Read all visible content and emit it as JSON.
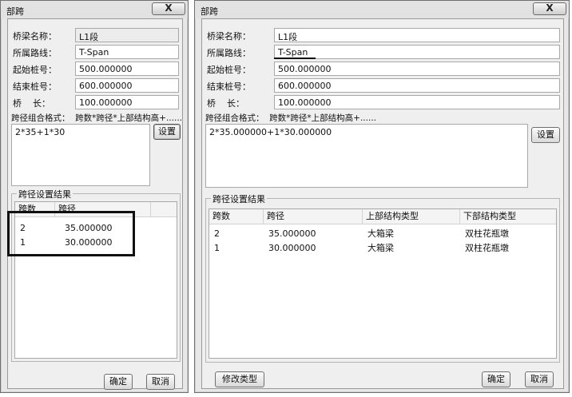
{
  "left_window": {
    "title": "部跨",
    "close_label": "X",
    "fields": [
      {
        "label": "桥梁名称：",
        "value": "L1段"
      },
      {
        "label": "所属路线：",
        "value": "T-Span"
      },
      {
        "label": "起始桩号：",
        "value": "500.000000"
      },
      {
        "label": "结束桩号：",
        "value": "600.000000"
      },
      {
        "label": "桥    长：",
        "value": "100.000000"
      }
    ],
    "format_label": "跨径组合格式：  跨数*跨径*上部结构高+......",
    "combo_text": "2*35+1*30",
    "settings_button": "设置",
    "group_title": "跨径设置结果",
    "columns": [
      "跨数",
      "跨径"
    ],
    "rows": [
      {
        "count": "2",
        "span": "35.000000"
      },
      {
        "count": "1",
        "span": "30.000000"
      }
    ],
    "ok_button": "确定",
    "cancel_button": "取消"
  },
  "right_window": {
    "title": "部跨",
    "close_label": "X",
    "fields": [
      {
        "label": "桥梁名称：",
        "value": "L1段"
      },
      {
        "label": "所属路线：",
        "value": "T-Span"
      },
      {
        "label": "起始桩号：",
        "value": "500.000000"
      },
      {
        "label": "结束桩号：",
        "value": "600.000000"
      },
      {
        "label": "桥    长：",
        "value": "100.000000"
      }
    ],
    "format_label": "跨径组合格式：  跨数*跨径*上部结构高+......",
    "combo_text": "2*35.000000+1*30.000000",
    "settings_button": "设置",
    "group_title": "跨径设置结果",
    "columns": [
      "跨数",
      "跨径",
      "上部结构类型",
      "下部结构类型"
    ],
    "rows": [
      {
        "count": "2",
        "span": "35.000000",
        "upper": "大箱梁",
        "lower": "双柱花瓶墩"
      },
      {
        "count": "1",
        "span": "30.000000",
        "upper": "大箱梁",
        "lower": "双柱花瓶墩"
      }
    ],
    "modify_button": "修改类型",
    "ok_button": "确定",
    "cancel_button": "取消"
  }
}
